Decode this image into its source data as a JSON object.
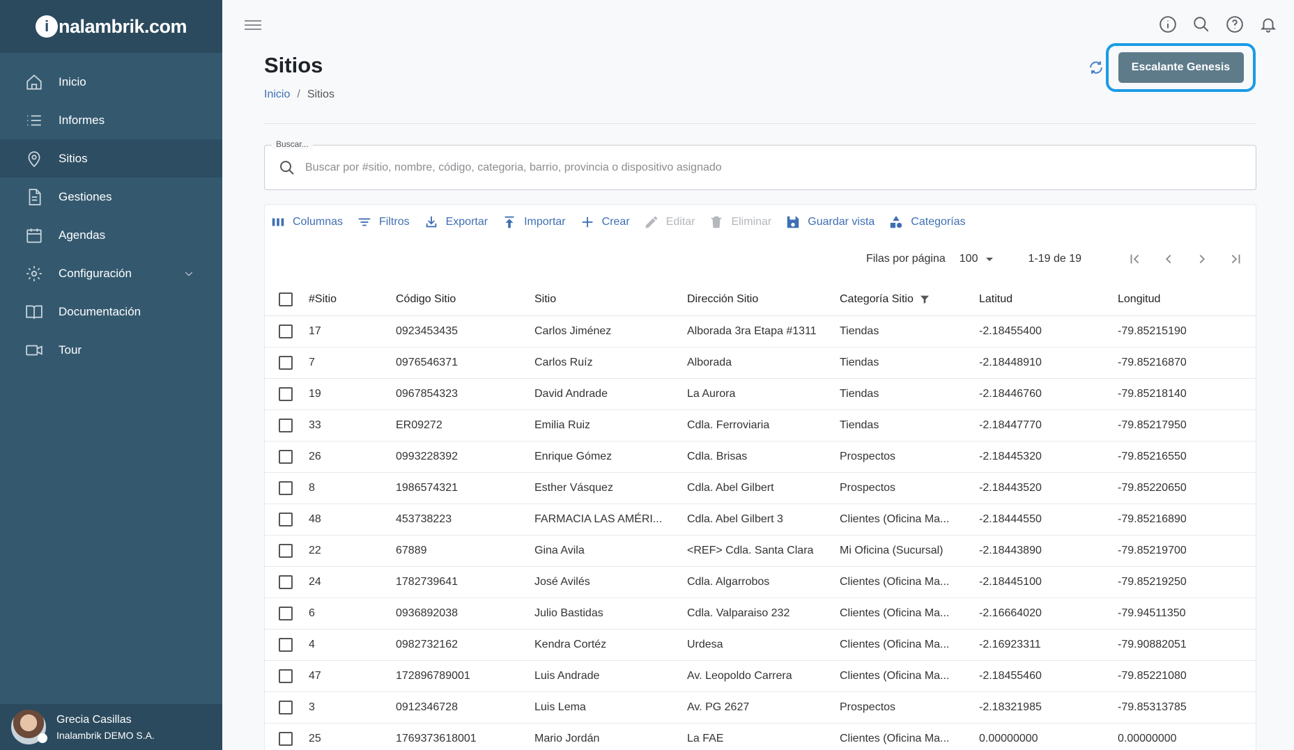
{
  "brand": {
    "logo_i": "i",
    "logo_rest": "nalambrik.com"
  },
  "sidebar": {
    "items": [
      {
        "label": "Inicio",
        "icon": "home-icon"
      },
      {
        "label": "Informes",
        "icon": "list-icon"
      },
      {
        "label": "Sitios",
        "icon": "location-pin-icon",
        "active": true
      },
      {
        "label": "Gestiones",
        "icon": "document-icon"
      },
      {
        "label": "Agendas",
        "icon": "calendar-icon"
      },
      {
        "label": "Configuración",
        "icon": "gear-icon",
        "expandable": true
      },
      {
        "label": "Documentación",
        "icon": "book-icon"
      },
      {
        "label": "Tour",
        "icon": "video-icon"
      }
    ]
  },
  "user": {
    "name": "Grecia Casillas",
    "org": "Inalambrik DEMO S.A."
  },
  "header": {
    "title": "Sitios",
    "breadcrumb": {
      "home": "Inicio",
      "sep": "/",
      "current": "Sitios"
    },
    "tenant_button": "Escalante Genesis"
  },
  "search": {
    "legend": "Buscar...",
    "placeholder": "Buscar por #sitio, nombre, código, categoria, barrio, provincia o dispositivo asignado"
  },
  "toolbar": {
    "columns": "Columnas",
    "filters": "Filtros",
    "export": "Exportar",
    "import": "Importar",
    "create": "Crear",
    "edit": "Editar",
    "delete": "Eliminar",
    "save_view": "Guardar vista",
    "categories": "Categorías"
  },
  "pager": {
    "rows_label": "Filas por página",
    "rows_value": "100",
    "count": "1-19 de 19"
  },
  "table": {
    "headers": [
      "#Sitio",
      "Código Sitio",
      "Sitio",
      "Dirección Sitio",
      "Categoría Sitio",
      "Latitud",
      "Longitud"
    ],
    "rows": [
      [
        "17",
        "0923453435",
        "Carlos Jiménez",
        "Alborada 3ra Etapa #1311",
        "Tiendas",
        "-2.18455400",
        "-79.85215190"
      ],
      [
        "7",
        "0976546371",
        "Carlos Ruíz",
        "Alborada",
        "Tiendas",
        "-2.18448910",
        "-79.85216870"
      ],
      [
        "19",
        "0967854323",
        "David Andrade",
        "La Aurora",
        "Tiendas",
        "-2.18446760",
        "-79.85218140"
      ],
      [
        "33",
        "ER09272",
        "Emilia Ruiz",
        "Cdla. Ferroviaria",
        "Tiendas",
        "-2.18447770",
        "-79.85217950"
      ],
      [
        "26",
        "0993228392",
        "Enrique Gómez",
        "Cdla. Brisas",
        "Prospectos",
        "-2.18445320",
        "-79.85216550"
      ],
      [
        "8",
        "1986574321",
        "Esther Vásquez",
        "Cdla. Abel Gilbert",
        "Prospectos",
        "-2.18443520",
        "-79.85220650"
      ],
      [
        "48",
        "453738223",
        "FARMACIA LAS AMÉRI...",
        "Cdla. Abel Gilbert 3",
        "Clientes (Oficina Ma...",
        "-2.18444550",
        "-79.85216890"
      ],
      [
        "22",
        "67889",
        "Gina Avila",
        "<REF> Cdla. Santa Clara",
        "Mi Oficina (Sucursal)",
        "-2.18443890",
        "-79.85219700"
      ],
      [
        "24",
        "1782739641",
        "José Avilés",
        "Cdla. Algarrobos",
        "Clientes (Oficina Ma...",
        "-2.18445100",
        "-79.85219250"
      ],
      [
        "6",
        "0936892038",
        "Julio Bastidas",
        "Cdla. Valparaiso 232",
        "Clientes (Oficina Ma...",
        "-2.16664020",
        "-79.94511350"
      ],
      [
        "4",
        "0982732162",
        "Kendra Cortéz",
        "Urdesa",
        "Clientes (Oficina Ma...",
        "-2.16923311",
        "-79.90882051"
      ],
      [
        "47",
        "172896789001",
        "Luis Andrade",
        "Av. Leopoldo Carrera",
        "Clientes (Oficina Ma...",
        "-2.18455460",
        "-79.85221080"
      ],
      [
        "3",
        "0912346728",
        "Luis Lema",
        "Av. PG 2627",
        "Prospectos",
        "-2.18321985",
        "-79.85313785"
      ],
      [
        "25",
        "1769373618001",
        "Mario Jordán",
        "La FAE",
        "Clientes (Oficina Ma...",
        "0.00000000",
        "0.00000000"
      ]
    ]
  },
  "colors": {
    "sidebar": "#34596f",
    "sidebar_dark": "#2b4a5e",
    "accent": "#3f6fb3",
    "highlight": "#1a9ce6",
    "tenant": "#5e7b8a"
  }
}
